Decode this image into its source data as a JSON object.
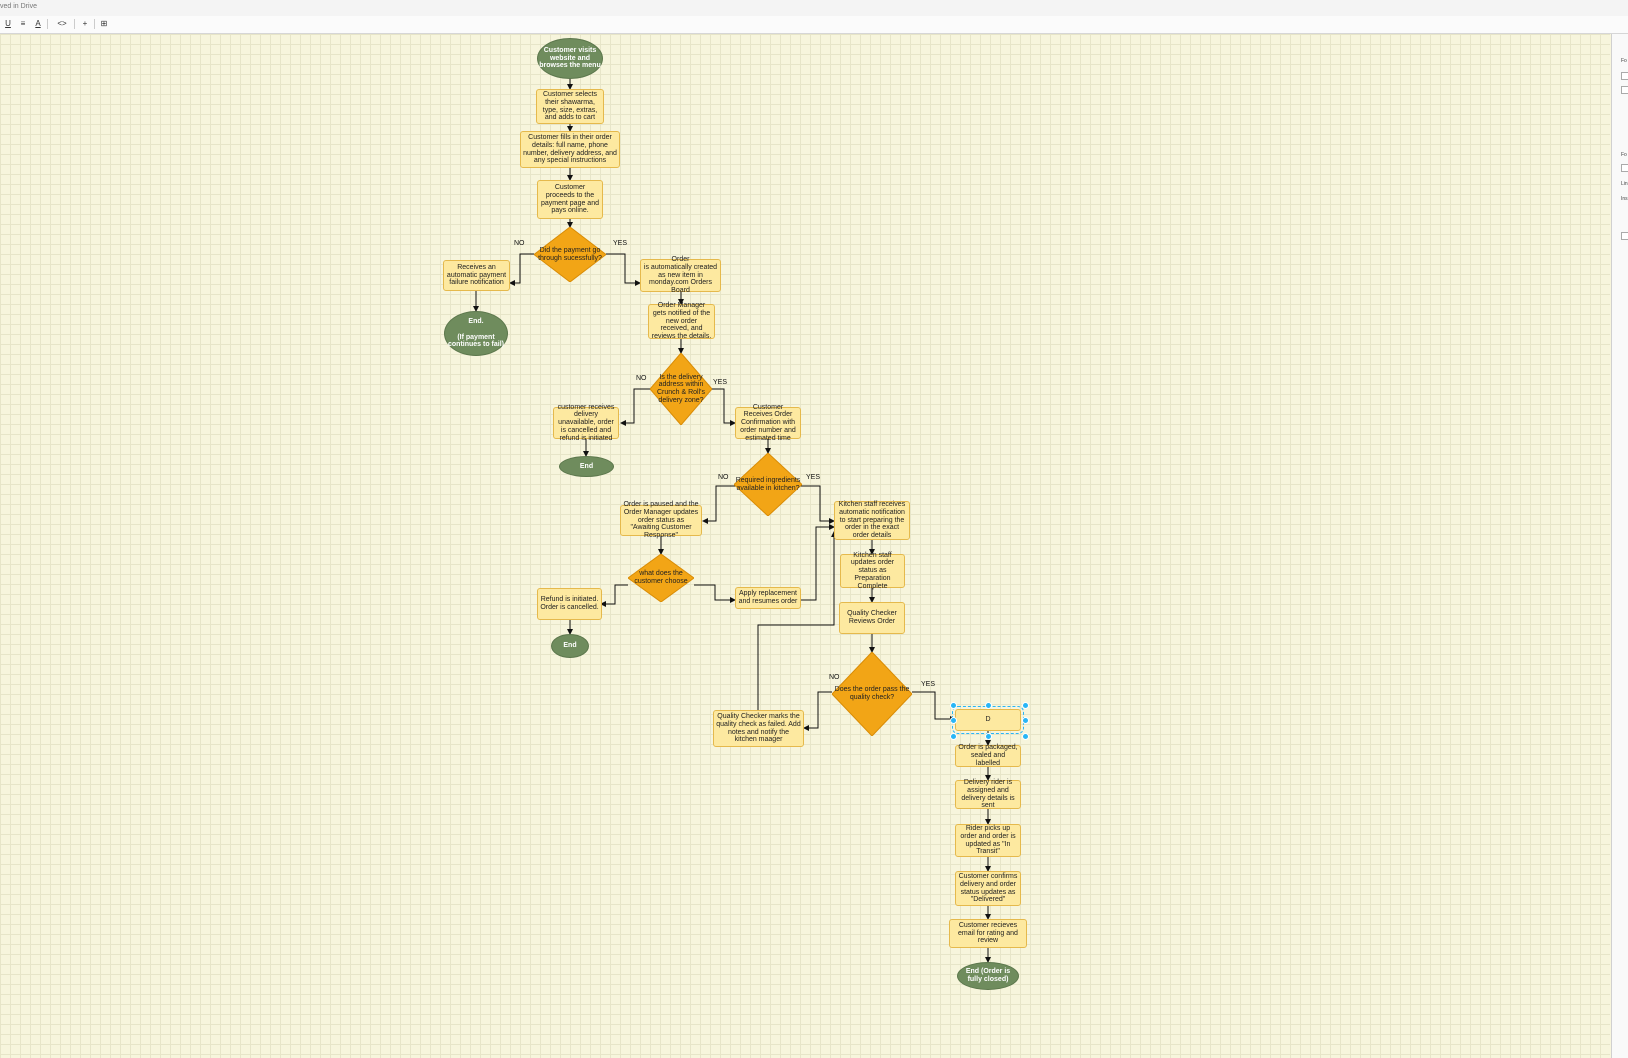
{
  "app": {
    "status": "ved in Drive",
    "toolbar": [
      "U",
      "≡",
      "A",
      "<>",
      "+",
      "⊞"
    ]
  },
  "colors": {
    "process_fill": "#fde9a0",
    "process_border": "#e5b94c",
    "decision_fill": "#f2a516",
    "terminal_fill": "#6f8c5d",
    "canvas": "#f7f5dc",
    "selection": "#29b6f6"
  },
  "right_panel": {
    "labels": [
      "Fo",
      "Fo",
      "Lin",
      "Ins"
    ]
  },
  "flowchart": {
    "start": "Customer visits website and browses the menu",
    "select_item": "Customer selects their shawarma, type, size, extras, and adds to cart",
    "fill_details": "Customer fills in their order details: full name, phone number, delivery address, and any special instructions",
    "payment": "Customer proceeds to the payment page and pays online.",
    "payment_decision": "Did the payment go through sucessfully?",
    "payment_no_label": "NO",
    "payment_yes_label": "YES",
    "payment_failure": "Receives an automatic payment failure notification",
    "end_payment_fail": "End.\n\n(If payment continues to fail)",
    "order_created": "Order\nis automatically created as new item in monday.com Orders Board",
    "manager_notified": "Order Manager gets notified of the new order received, and reviews the details.",
    "zone_decision": "Is the delivery address within Crunch & Roll's delivery zone?",
    "zone_no_label": "NO",
    "zone_yes_label": "YES",
    "delivery_unavailable": "customer receives delivery unavailable, order is cancelled and refund is initiated",
    "end_zone": "End",
    "order_confirmation": "Customer Receives Order Confirmation with order number and estimated time",
    "ingredients_decision": "Required ingredients available in kitchen?",
    "ingredients_no_label": "NO",
    "ingredients_yes_label": "YES",
    "order_paused": "Order is paused and the Order Manager updates order status as \"Awaiting Customer Response\"",
    "customer_choice": "what does the customer choose",
    "refund": "Refund is initiated. Order is cancelled.",
    "end_refund": "End",
    "apply_replacement": "Apply replacement and resumes order",
    "kitchen_notified": "Kitchen staff receives automatic notification to start preparing the order in the exact order details",
    "prep_complete": "Kitchen staff updates order status as Preparation Complete",
    "quality_review": "Quality Checker Reviews Order",
    "quality_decision": "Does the order pass the quality check?",
    "quality_no_label": "NO",
    "quality_yes_label": "YES",
    "quality_failed": "Quality Checker marks the quality check as failed. Add notes and notify the kitchen maager",
    "selected_box": "D",
    "packaged": "Order is packaged, sealed and labelled",
    "rider_assigned": "Delivery rider is assigned and delivery details is sent",
    "in_transit": "Rider picks up order and order is updated as \"In Transit\"",
    "delivered": "Customer confirms delivery and order status updates as \"Delivered\"",
    "rating_email": "Customer recieves email for rating and review",
    "end_final": "End (Order is fully closed)"
  }
}
